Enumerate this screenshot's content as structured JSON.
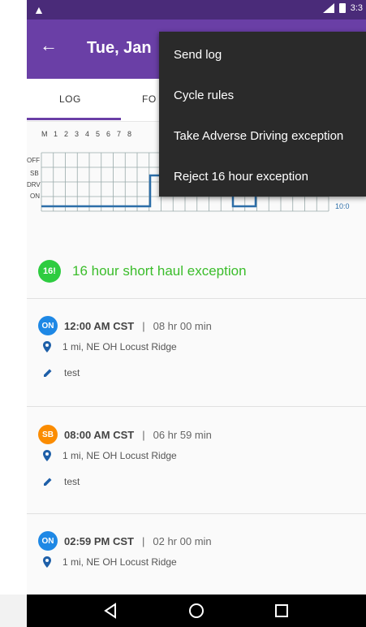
{
  "status_bar": {
    "time": "3:3",
    "warn_icon": "warning-icon"
  },
  "appbar": {
    "title": "Tue, Jan",
    "back_icon": "back-arrow-icon"
  },
  "tabs": [
    {
      "label": "LOG"
    },
    {
      "label": "FO"
    }
  ],
  "graph": {
    "hour_labels": [
      "M",
      "1",
      "2",
      "3",
      "4",
      "5",
      "6",
      "7",
      "8"
    ],
    "row_labels": [
      "OFF",
      "SB",
      "DRV",
      "ON"
    ],
    "right_value": "10:0"
  },
  "menu": {
    "items": [
      "Send log",
      "Cycle rules",
      "Take Adverse Driving exception",
      "Reject 16 hour exception"
    ]
  },
  "exception": {
    "badge": "16!",
    "text": "16 hour short haul exception"
  },
  "entries": [
    {
      "status": "ON",
      "time": "12:00 AM CST",
      "sep": "|",
      "duration": "08 hr 00 min",
      "location": "1 mi, NE OH Locust Ridge",
      "note": "test"
    },
    {
      "status": "SB",
      "time": "08:00 AM CST",
      "sep": "|",
      "duration": "06 hr 59 min",
      "location": "1 mi, NE OH Locust Ridge",
      "note": "test"
    },
    {
      "status": "ON",
      "time": "02:59 PM CST",
      "sep": "|",
      "duration": "02 hr 00 min",
      "location": "1 mi, NE OH Locust Ridge"
    }
  ],
  "colors": {
    "primary": "#6a3fa6",
    "status_bar": "#4a2b79",
    "on_blue": "#1e88e5",
    "sb_orange": "#fb8c00",
    "exception_green": "#3bbd2b",
    "menu_bg": "#2a2a2a"
  }
}
